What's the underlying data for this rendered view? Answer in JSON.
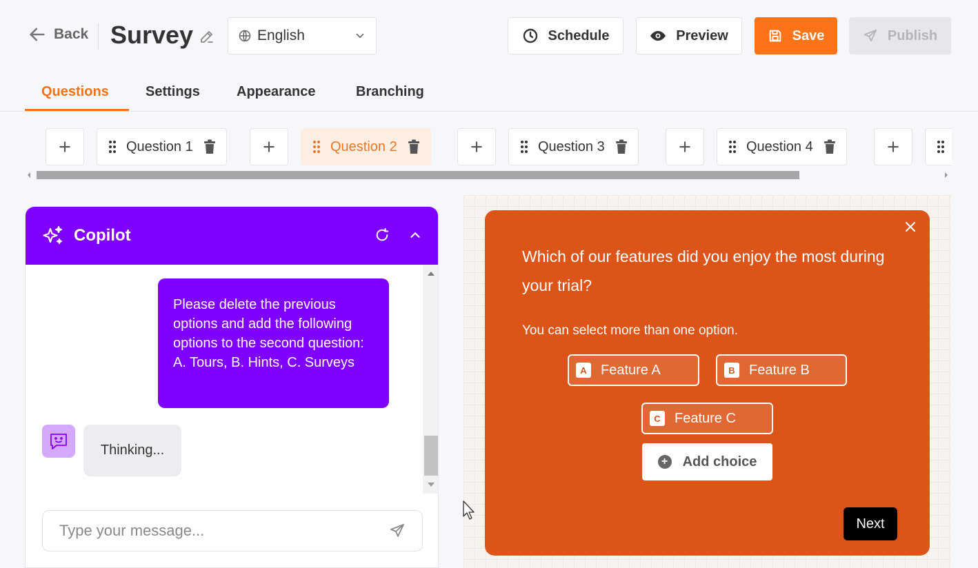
{
  "header": {
    "back_label": "Back",
    "title": "Survey",
    "language": "English",
    "schedule_label": "Schedule",
    "preview_label": "Preview",
    "save_label": "Save",
    "publish_label": "Publish"
  },
  "tabs": [
    {
      "label": "Questions",
      "active": true
    },
    {
      "label": "Settings"
    },
    {
      "label": "Appearance"
    },
    {
      "label": "Branching"
    }
  ],
  "questions": [
    {
      "label": "Question 1"
    },
    {
      "label": "Question 2",
      "active": true
    },
    {
      "label": "Question 3"
    },
    {
      "label": "Question 4"
    }
  ],
  "copilot": {
    "title": "Copilot",
    "user_message": "Please delete the previous options and add the following options to the second question: A. Tours, B. Hints, C. Surveys",
    "bot_message": "Thinking...",
    "input_placeholder": "Type your message..."
  },
  "survey": {
    "question": "Which of our features did you enjoy the most during your trial?",
    "subtitle": "You can select more than one option.",
    "choices": [
      {
        "letter": "A",
        "label": "Feature A"
      },
      {
        "letter": "B",
        "label": "Feature B"
      },
      {
        "letter": "C",
        "label": "Feature C"
      }
    ],
    "add_choice_label": "Add choice",
    "next_label": "Next"
  },
  "colors": {
    "accent_orange": "#fd7318",
    "copilot_purple": "#8000ff",
    "card_orange": "#dd5419"
  }
}
